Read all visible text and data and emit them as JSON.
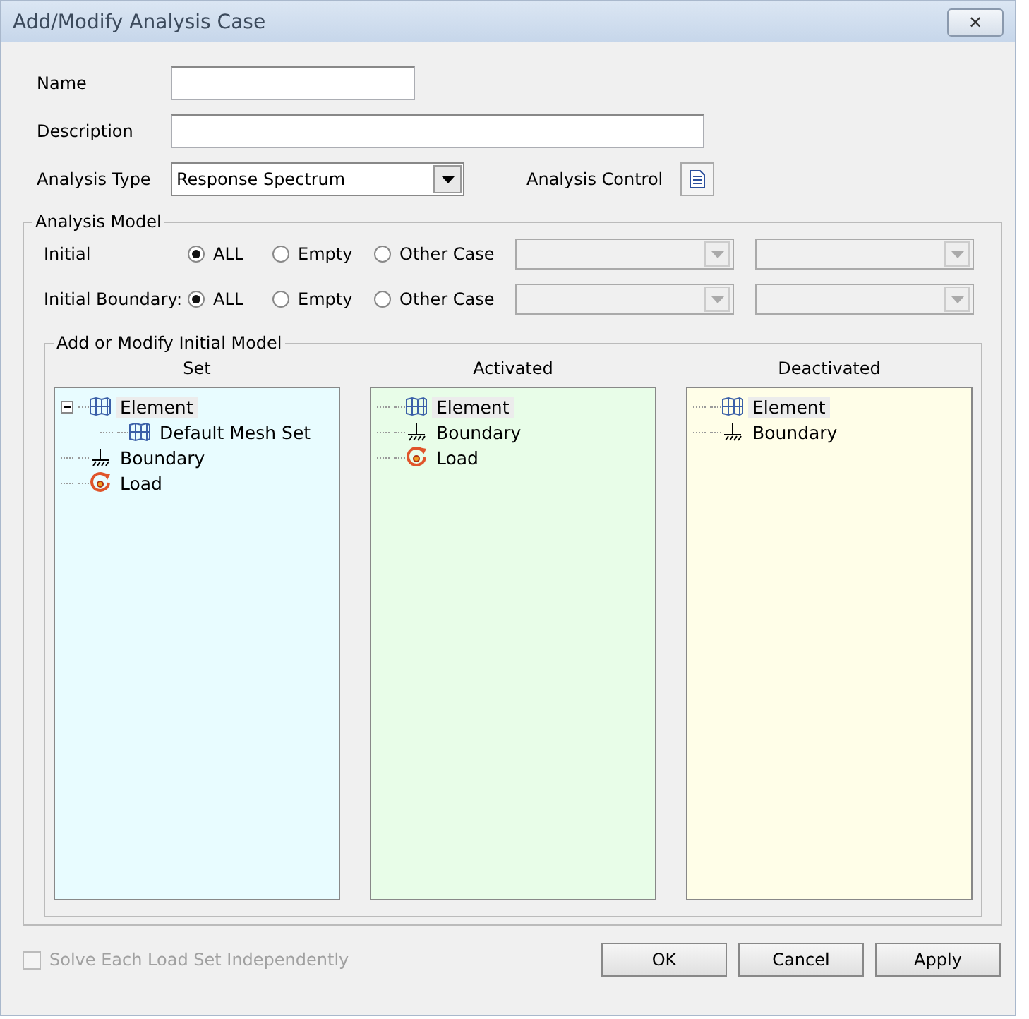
{
  "window": {
    "title": "Add/Modify Analysis Case",
    "close": "✕"
  },
  "fields": [
    {
      "label": "Name"
    },
    {
      "label": "Description"
    }
  ],
  "analysis_type": {
    "label": "Analysis Type",
    "value": "Response Spectrum"
  },
  "analysis_control": {
    "label": "Analysis Control"
  },
  "analysis_model": {
    "title": "Analysis Model",
    "rows": [
      {
        "label": "Initial",
        "options": [
          {
            "label": "ALL",
            "selected": true
          },
          {
            "label": "Empty",
            "selected": false
          },
          {
            "label": "Other Case",
            "selected": false
          }
        ],
        "combos_disabled": true
      },
      {
        "label": "Initial Boundary:",
        "options": [
          {
            "label": "ALL",
            "selected": true
          },
          {
            "label": "Empty",
            "selected": false
          },
          {
            "label": "Other Case",
            "selected": false
          }
        ],
        "combos_disabled": true
      }
    ]
  },
  "initial_model": {
    "title": "Add or Modify Initial Model",
    "panels": [
      {
        "heading": "Set",
        "color": "#e8fcff",
        "items": [
          {
            "kind": "element",
            "label": "Element",
            "selected": true,
            "expanded": true,
            "children": [
              {
                "kind": "element",
                "label": "Default Mesh Set",
                "selected": false
              }
            ]
          },
          {
            "kind": "boundary",
            "label": "Boundary",
            "selected": false
          },
          {
            "kind": "load",
            "label": "Load",
            "selected": false
          }
        ]
      },
      {
        "heading": "Activated",
        "color": "#e8fde8",
        "items": [
          {
            "kind": "element",
            "label": "Element",
            "selected": true
          },
          {
            "kind": "boundary",
            "label": "Boundary",
            "selected": false
          },
          {
            "kind": "load",
            "label": "Load",
            "selected": false
          }
        ]
      },
      {
        "heading": "Deactivated",
        "color": "#fffee8",
        "items": [
          {
            "kind": "element",
            "label": "Element",
            "selected": true
          },
          {
            "kind": "boundary",
            "label": "Boundary",
            "selected": false
          }
        ]
      }
    ]
  },
  "solve_independently": {
    "label": "Solve Each Load Set Independently",
    "checked": false,
    "disabled": true
  },
  "buttons": [
    "OK",
    "Cancel",
    "Apply"
  ]
}
